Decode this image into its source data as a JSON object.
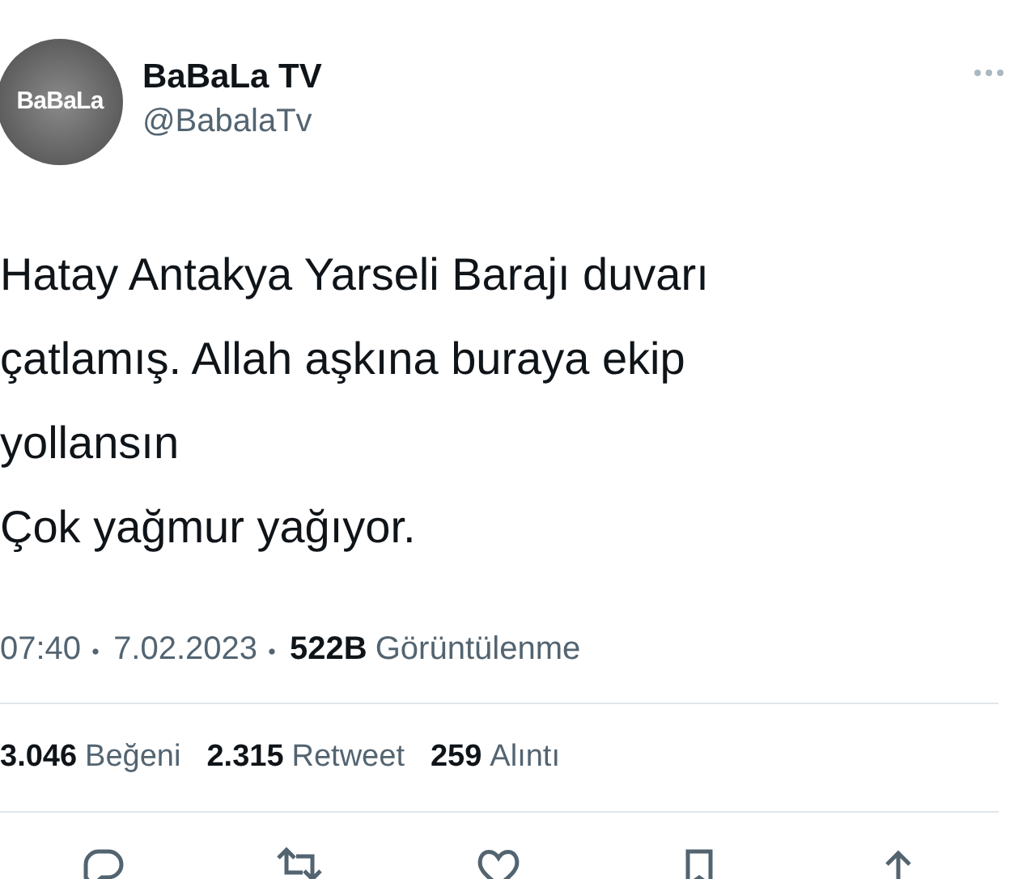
{
  "author": {
    "avatar_logo": "BaBaLa",
    "name": "BaBaLa TV",
    "handle": "@BabalaTv"
  },
  "tweet_lines": [
    "Hatay Antakya Yarseli Barajı duvarı",
    "çatlamış. Allah aşkına buraya ekip",
    "yollansın",
    "Çok yağmur yağıyor."
  ],
  "meta": {
    "time": "07:40",
    "date": "7.02.2023",
    "views_count": "522B",
    "views_label": "Görüntülenme"
  },
  "stats": [
    {
      "count": "3.046",
      "label": "Beğeni"
    },
    {
      "count": "2.315",
      "label": "Retweet"
    },
    {
      "count": "259",
      "label": "Alıntı"
    }
  ],
  "actions": [
    {
      "kind": "reply"
    },
    {
      "kind": "retweet"
    },
    {
      "kind": "like"
    },
    {
      "kind": "bookmark"
    },
    {
      "kind": "share"
    }
  ]
}
